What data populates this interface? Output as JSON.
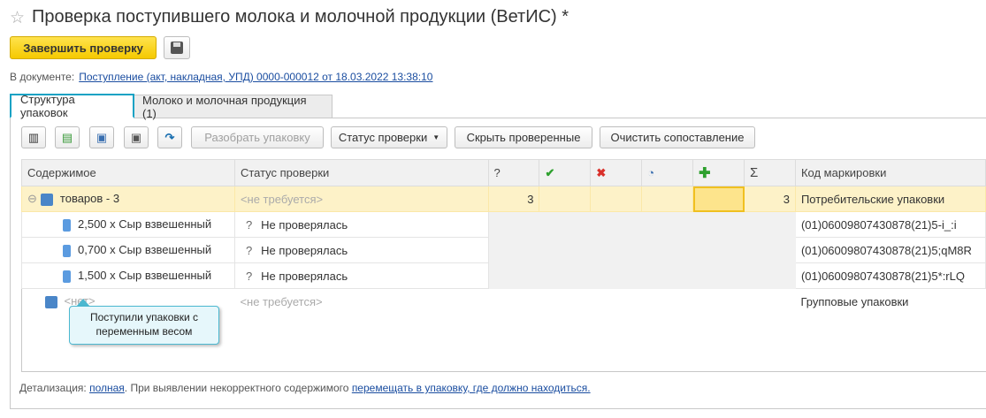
{
  "header": {
    "title": "Проверка поступившего молока и молочной продукции (ВетИС) *",
    "finish_label": "Завершить проверку"
  },
  "document": {
    "label": "В документе:",
    "link": "Поступление (акт, накладная, УПД) 0000-000012 от 18.03.2022 13:38:10"
  },
  "tabs": [
    {
      "label": "Структура упаковок"
    },
    {
      "label": "Молоко и молочная продукция (1)"
    }
  ],
  "toolbar": {
    "disassemble": "Разобрать упаковку",
    "status": "Статус проверки",
    "hide_checked": "Скрыть проверенные",
    "clear_match": "Очистить сопоставление"
  },
  "table": {
    "headers": {
      "content": "Содержимое",
      "status": "Статус проверки",
      "question": "?",
      "code": "Код маркировки"
    },
    "rows": [
      {
        "content": "товаров - 3",
        "status": "<не требуется>",
        "q": "3",
        "sum": "3",
        "code": "Потребительские упаковки"
      },
      {
        "content": "2,500 x Сыр взвешенный",
        "status_icon": "?",
        "status": "Не проверялась",
        "code": "(01)06009807430878(21)5-i_:i"
      },
      {
        "content": "0,700 x Сыр взвешенный",
        "status_icon": "?",
        "status": "Не проверялась",
        "code": "(01)06009807430878(21)5;qM8R"
      },
      {
        "content": "1,500 x Сыр взвешенный",
        "status_icon": "?",
        "status": "Не проверялась",
        "code": "(01)06009807430878(21)5*:rLQ"
      },
      {
        "content": "<нет>",
        "status": "<не требуется>",
        "code": "Групповые упаковки"
      }
    ]
  },
  "tooltip": "Поступили упаковки с переменным весом",
  "footer": {
    "label": "Детализация:",
    "link1": "полная",
    "text": ". При выявлении некорректного содержимого",
    "link2": "перемещать в упаковку, где должно находиться."
  }
}
